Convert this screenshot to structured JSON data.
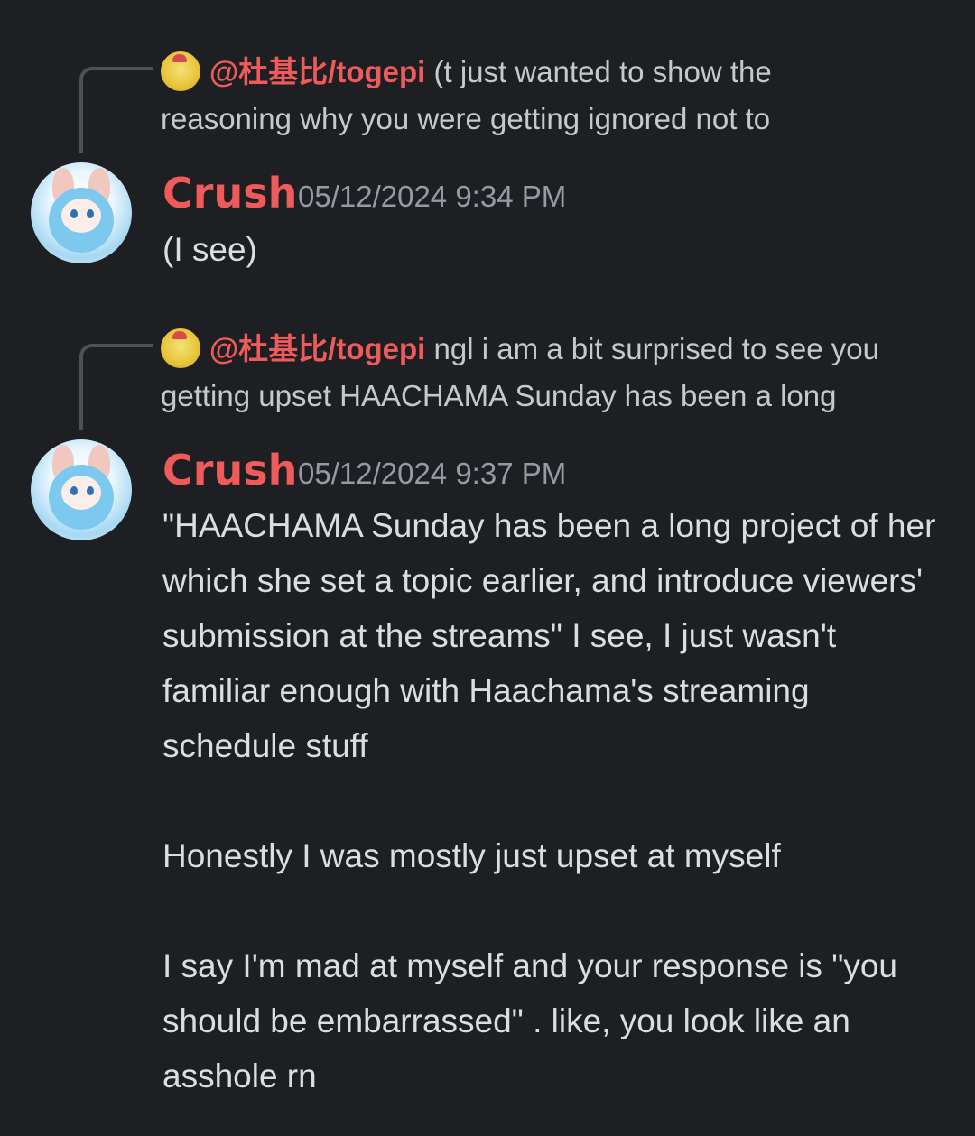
{
  "messages": [
    {
      "reply": {
        "mention": "@杜基比/togepi",
        "line1": " (t just wanted to show the",
        "line2": "reasoning why you were getting ignored not to"
      },
      "author": "Crush",
      "timestamp": "05/12/2024 9:34 PM",
      "paragraphs": [
        "(I see)"
      ]
    },
    {
      "reply": {
        "mention": "@杜基比/togepi",
        "line1": " ngl i am a bit surprised to see you",
        "line2": "getting upset HAACHAMA Sunday has been a long"
      },
      "author": "Crush",
      "timestamp": "05/12/2024 9:37 PM",
      "paragraphs": [
        "\"HAACHAMA Sunday has been a long project of her which she set a topic earlier, and introduce viewers' submission at the streams\" I see, I just wasn't familiar enough with Haachama's streaming schedule stuff",
        "",
        "Honestly I was mostly just upset at myself",
        "",
        "I say I'm mad at myself and your response is \"you should be embarrassed\" . like, you look like an asshole rn"
      ]
    }
  ],
  "colors": {
    "background": "#1e1f22",
    "username": "#ef5b5b",
    "mention": "#ef5b5b",
    "timestamp": "#949ba4",
    "text": "#dbdee1"
  },
  "icons": {
    "reply_avatar": "togepi-avatar-icon",
    "author_avatar": "crush-avatar-icon"
  }
}
